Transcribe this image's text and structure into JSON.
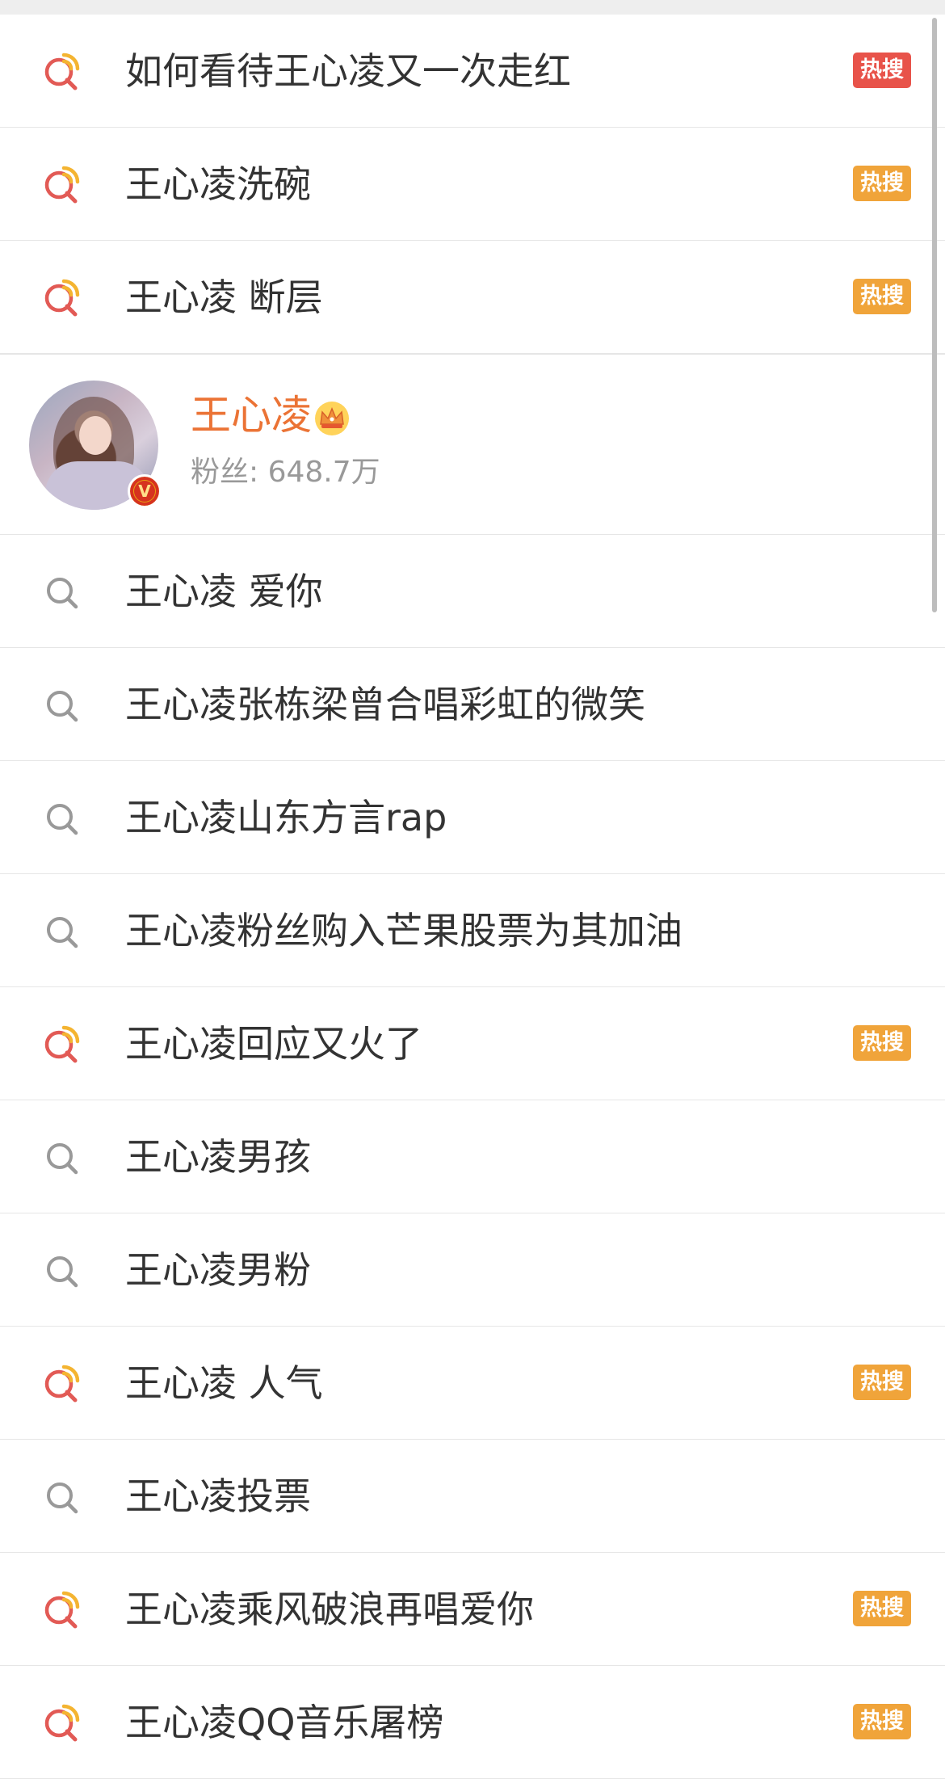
{
  "colors": {
    "hot_badge_red": "#e8534a",
    "hot_badge_orange": "#f0a43a",
    "name_orange": "#eb7335",
    "text_main": "#333333",
    "text_secondary": "#999999",
    "divider": "#e6e6e6"
  },
  "suggestions_top": [
    {
      "text": "如何看待王心凌又一次走红",
      "icon": "hot-search-icon",
      "badge": "热搜",
      "badge_color": "red"
    },
    {
      "text": "王心凌洗碗",
      "icon": "hot-search-icon",
      "badge": "热搜",
      "badge_color": "orange"
    },
    {
      "text": "王心凌 断层",
      "icon": "hot-search-icon",
      "badge": "热搜",
      "badge_color": "orange"
    }
  ],
  "profile": {
    "name": "王心凌",
    "crown_icon": "crown-icon",
    "verified_icon": "verified-v-icon",
    "verified_mark": "V",
    "fans_label": "粉丝: 648.7万"
  },
  "suggestions_bottom": [
    {
      "text": "王心凌 爱你",
      "icon": "search-icon",
      "badge": "",
      "badge_color": ""
    },
    {
      "text": "王心凌张栋梁曾合唱彩虹的微笑",
      "icon": "search-icon",
      "badge": "",
      "badge_color": ""
    },
    {
      "text": "王心凌山东方言rap",
      "icon": "search-icon",
      "badge": "",
      "badge_color": ""
    },
    {
      "text": "王心凌粉丝购入芒果股票为其加油",
      "icon": "search-icon",
      "badge": "",
      "badge_color": ""
    },
    {
      "text": "王心凌回应又火了",
      "icon": "hot-search-icon",
      "badge": "热搜",
      "badge_color": "orange"
    },
    {
      "text": "王心凌男孩",
      "icon": "search-icon",
      "badge": "",
      "badge_color": ""
    },
    {
      "text": "王心凌男粉",
      "icon": "search-icon",
      "badge": "",
      "badge_color": ""
    },
    {
      "text": "王心凌 人气",
      "icon": "hot-search-icon",
      "badge": "热搜",
      "badge_color": "orange"
    },
    {
      "text": "王心凌投票",
      "icon": "search-icon",
      "badge": "",
      "badge_color": ""
    },
    {
      "text": "王心凌乘风破浪再唱爱你",
      "icon": "hot-search-icon",
      "badge": "热搜",
      "badge_color": "orange"
    },
    {
      "text": "王心凌QQ音乐屠榜",
      "icon": "hot-search-icon",
      "badge": "热搜",
      "badge_color": "orange"
    }
  ]
}
